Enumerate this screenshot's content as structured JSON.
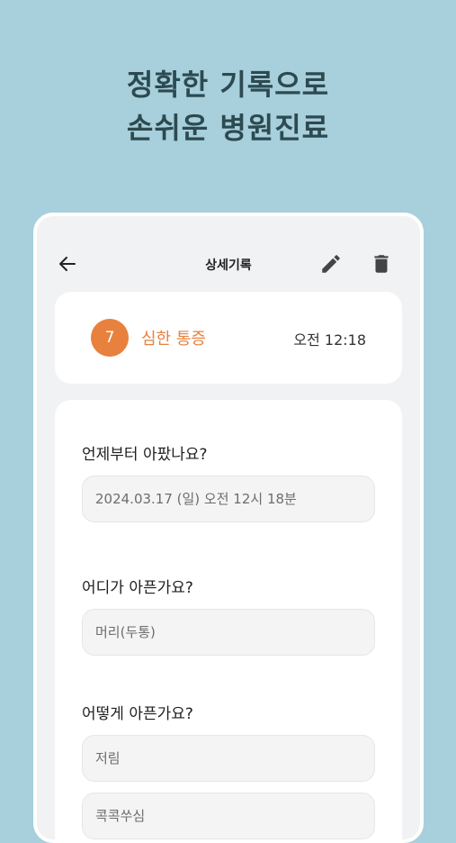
{
  "headline": {
    "line1": "정확한 기록으로",
    "line2": "손쉬운 병원진료"
  },
  "appbar": {
    "title": "상세기록",
    "back_icon": "arrow-left-icon",
    "edit_icon": "pencil-icon",
    "delete_icon": "trash-icon"
  },
  "summary": {
    "level": "7",
    "label": "심한 통증",
    "time": "오전 12:18",
    "accent_color": "#e8813e"
  },
  "questions": [
    {
      "label": "언제부터 아팠나요?",
      "values": [
        "2024.03.17 (일) 오전 12시 18분"
      ]
    },
    {
      "label": "어디가 아픈가요?",
      "values": [
        "머리(두통)"
      ]
    },
    {
      "label": "어떻게 아픈가요?",
      "values": [
        "저림",
        "콕콕쑤심"
      ]
    }
  ]
}
